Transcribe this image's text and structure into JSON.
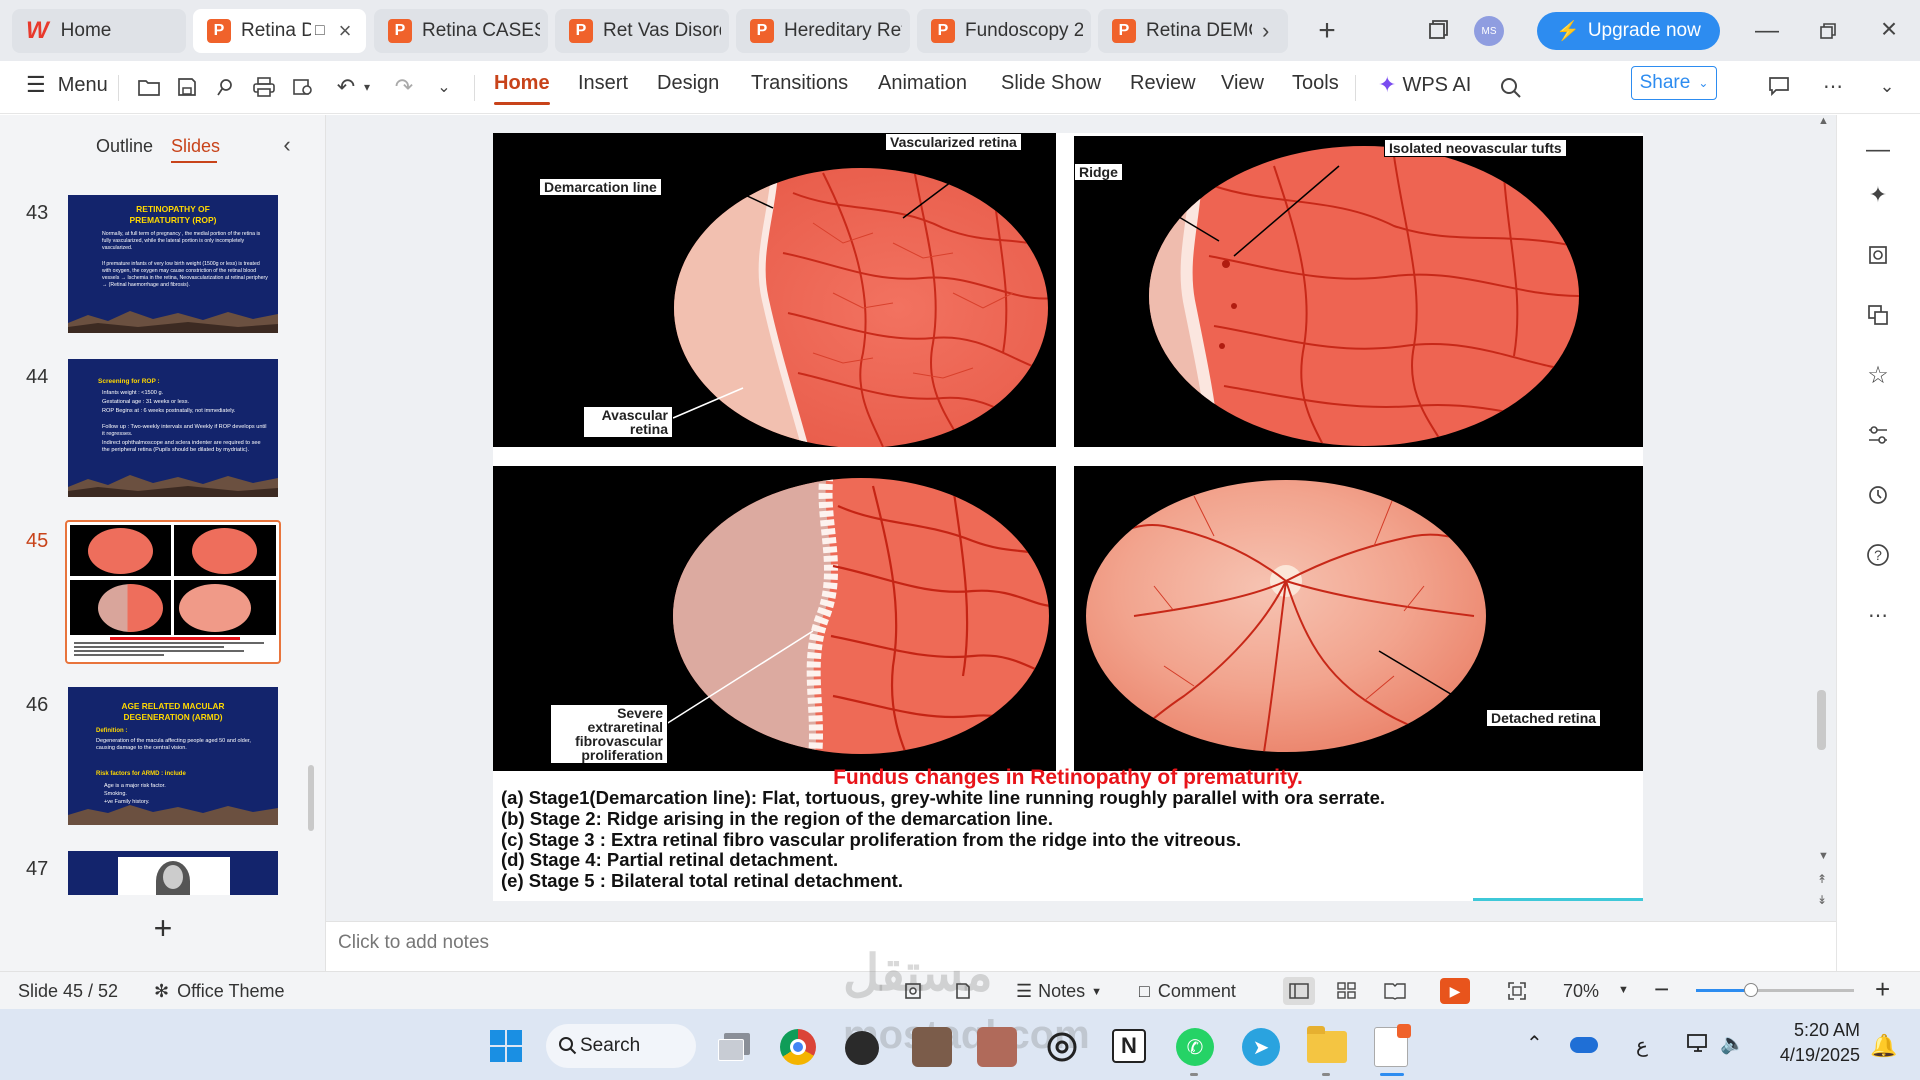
{
  "tabs": {
    "home": "Home",
    "items": [
      {
        "label": "Retina DISORDERS"
      },
      {
        "label": "Retina CASES"
      },
      {
        "label": "Ret Vas Disorders"
      },
      {
        "label": "Hereditary Retina"
      },
      {
        "label": "Fundoscopy 2"
      },
      {
        "label": "Retina DEMO"
      }
    ],
    "avatar": "MS",
    "upgrade": "Upgrade now"
  },
  "ribbon": {
    "menu": "Menu",
    "tabs": [
      "Home",
      "Insert",
      "Design",
      "Transitions",
      "Animation",
      "Slide Show",
      "Review",
      "View",
      "Tools"
    ],
    "wps_ai": "WPS AI",
    "share": "Share"
  },
  "left_panel": {
    "outline": "Outline",
    "slides": "Slides",
    "numbers": [
      "43",
      "44",
      "45",
      "46",
      "47"
    ],
    "thumb43": {
      "title": "RETINOPATHY OF PREMATURITY (ROP)",
      "p1": "Normally, at full term of pregnancy , the medial portion of the retina is fully vascularized, while the lateral portion is only incompletely vascularized.",
      "p2": "If premature infants of very low birth weight (1500g or less) is treated with oxygen, the oxygen may cause constriction of the retinal blood vessels → Ischemia in the retina, Neovascularization at retinal periphery → (Retinal haemorrhage and fibrosis)."
    },
    "thumb44": {
      "title": "Screening for ROP :",
      "lines": [
        "Infants weight : <1500 g.",
        "Gestational age : 31 weeks or less.",
        "ROP Begins at : 6 weeks postnatally, not immediately.",
        "Follow up : Two-weekly intervals and Weekly if ROP develops until it regresses.",
        "Indirect ophthalmoscope and sclera indenter are required to see the peripheral retina (Pupils should be dilated by mydriatic)."
      ]
    },
    "thumb46": {
      "title": "AGE RELATED MACULAR DEGENERATION (ARMD)",
      "def_label": "Definition :",
      "def": "Degeneration of the macula affecting people aged 50 and older, causing damage to the central vision.",
      "risk_label": "Risk factors for ARMD : include",
      "risks": [
        "Age is a major risk factor.",
        "Smoking.",
        "+ve Family history."
      ]
    }
  },
  "slide": {
    "labels": {
      "vascularized": "Vascularized retina",
      "demarcation": "Demarcation line",
      "avascular": "Avascular retina",
      "ridge": "Ridge",
      "tufts": "Isolated neovascular tufts",
      "severe": "Severe extraretinal fibrovascular proliferation",
      "detached": "Detached retina"
    },
    "title": "Fundus changes in Retinopathy of prematurity.",
    "stages": [
      "(a)  Stage1(Demarcation line): Flat, tortuous, grey-white  line  running  roughly parallel with ora serrate.",
      "(b)  Stage 2:  Ridge arising in the region of the demarcation line.",
      "(c)  Stage 3   :  Extra retinal fibro vascular proliferation from the ridge into the vitreous.",
      "(d)  Stage 4:   Partial retinal detachment.",
      "(e)  Stage 5   :  Bilateral total retinal detachment."
    ]
  },
  "notes_placeholder": "Click to add notes",
  "status": {
    "slide": "Slide 45 / 52",
    "theme": "Office Theme",
    "notes": "Notes",
    "comment": "Comment",
    "zoom": "70%",
    "zoom_level": 0.35
  },
  "watermark": {
    "arabic": "مستقل",
    "latin": "mostaql.com"
  },
  "taskbar": {
    "search": "Search",
    "time": "5:20 AM",
    "date": "4/19/2025",
    "lang": "ع"
  },
  "colors": {
    "accent": "#c8431a",
    "upgrade": "#2d8cf0",
    "slide_bg": "#13246c",
    "title_red": "#e8141a",
    "retina": "#f07a66"
  }
}
